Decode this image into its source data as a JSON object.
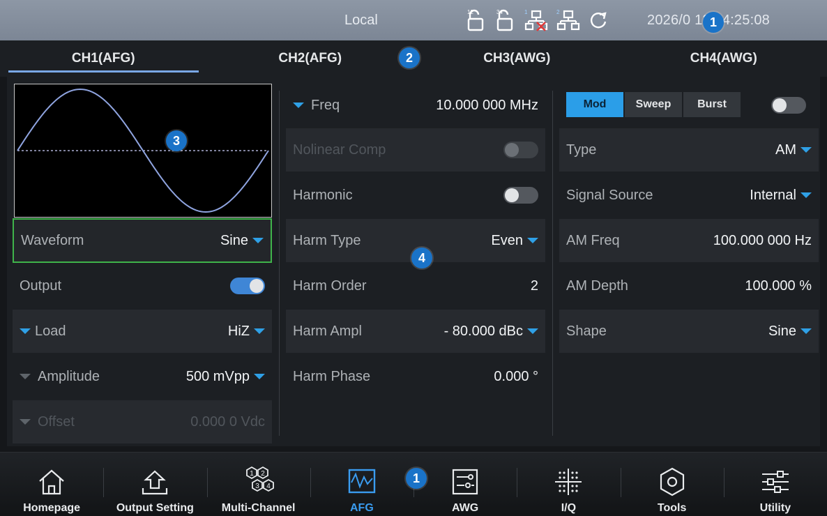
{
  "status": {
    "title": "Local",
    "datetime": "2026/0 13 14:25:08",
    "icons": [
      "channel-12-icon",
      "channel-34-icon",
      "network-1-icon",
      "network-2-icon",
      "refresh-icon"
    ]
  },
  "tabs": [
    {
      "label": "CH1(AFG)",
      "active": true
    },
    {
      "label": "CH2(AFG)",
      "active": false
    },
    {
      "label": "CH3(AWG)",
      "active": false
    },
    {
      "label": "CH4(AWG)",
      "active": false
    }
  ],
  "left": {
    "waveform": {
      "label": "Waveform",
      "value": "Sine"
    },
    "output": {
      "label": "Output",
      "on": true
    },
    "load": {
      "label": "Load",
      "value": "HiZ"
    },
    "amplitude": {
      "label": "Amplitude",
      "value": "500 mVpp"
    },
    "offset": {
      "label": "Offset",
      "value": "0.000 0 Vdc"
    }
  },
  "middle": {
    "freq": {
      "label": "Freq",
      "value": "10.000 000 MHz"
    },
    "nolinear": {
      "label": "Nolinear Comp"
    },
    "harmonic": {
      "label": "Harmonic",
      "on": false
    },
    "harm_type": {
      "label": "Harm Type",
      "value": "Even"
    },
    "harm_order": {
      "label": "Harm Order",
      "value": "2"
    },
    "harm_ampl": {
      "label": "Harm Ampl",
      "value": "- 80.000 dBc"
    },
    "harm_phase": {
      "label": "Harm Phase",
      "value": "0.000 °"
    }
  },
  "right": {
    "modes": [
      "Mod",
      "Sweep",
      "Burst"
    ],
    "active_mode": "Mod",
    "type": {
      "label": "Type",
      "value": "AM"
    },
    "source": {
      "label": "Signal Source",
      "value": "Internal"
    },
    "am_freq": {
      "label": "AM Freq",
      "value": "100.000 000 Hz"
    },
    "am_depth": {
      "label": "AM Depth",
      "value": "100.000 %"
    },
    "shape": {
      "label": "Shape",
      "value": "Sine"
    }
  },
  "badges": [
    "1",
    "2",
    "3",
    "4",
    "1"
  ],
  "nav": [
    {
      "label": "Homepage",
      "icon": "home-icon"
    },
    {
      "label": "Output Setting",
      "icon": "output-setting-icon"
    },
    {
      "label": "Multi-Channel",
      "icon": "multi-channel-icon"
    },
    {
      "label": "AFG",
      "icon": "afg-icon",
      "active": true
    },
    {
      "label": "AWG",
      "icon": "awg-icon"
    },
    {
      "label": "I/Q",
      "icon": "iq-icon"
    },
    {
      "label": "Tools",
      "icon": "tools-icon"
    },
    {
      "label": "Utility",
      "icon": "utility-icon"
    }
  ],
  "colors": {
    "accent": "#2fa0e6",
    "selected_border": "#3fb44a",
    "toggle_on": "#3f86d6",
    "waveform": "#8fa4e0"
  }
}
